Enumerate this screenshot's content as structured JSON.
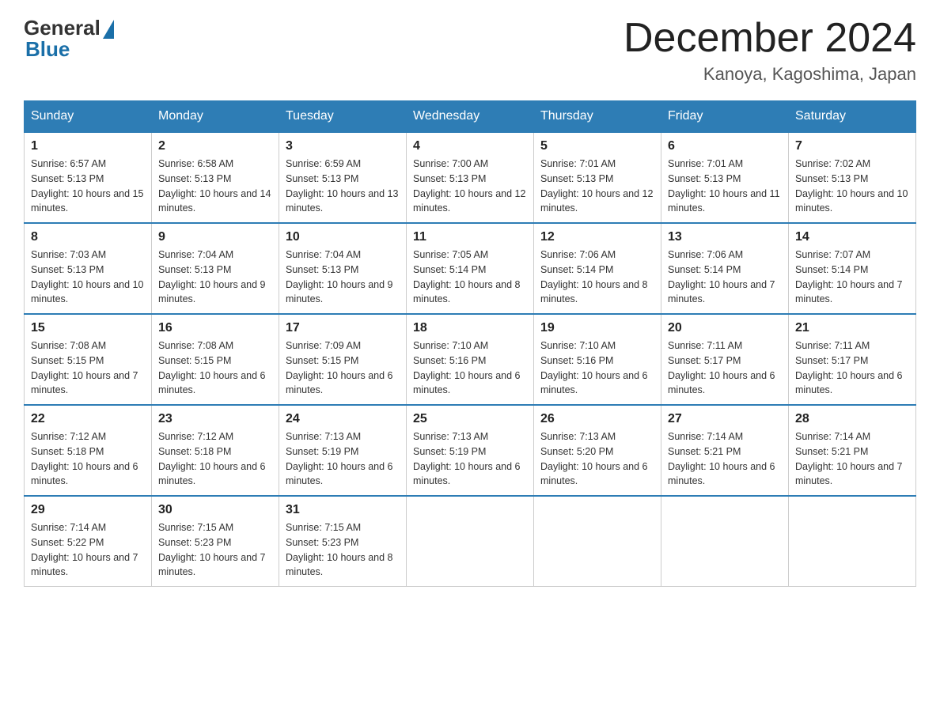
{
  "header": {
    "logo_general": "General",
    "logo_blue": "Blue",
    "month_title": "December 2024",
    "location": "Kanoya, Kagoshima, Japan"
  },
  "days_of_week": [
    "Sunday",
    "Monday",
    "Tuesday",
    "Wednesday",
    "Thursday",
    "Friday",
    "Saturday"
  ],
  "weeks": [
    [
      {
        "day": "1",
        "sunrise": "6:57 AM",
        "sunset": "5:13 PM",
        "daylight": "10 hours and 15 minutes."
      },
      {
        "day": "2",
        "sunrise": "6:58 AM",
        "sunset": "5:13 PM",
        "daylight": "10 hours and 14 minutes."
      },
      {
        "day": "3",
        "sunrise": "6:59 AM",
        "sunset": "5:13 PM",
        "daylight": "10 hours and 13 minutes."
      },
      {
        "day": "4",
        "sunrise": "7:00 AM",
        "sunset": "5:13 PM",
        "daylight": "10 hours and 12 minutes."
      },
      {
        "day": "5",
        "sunrise": "7:01 AM",
        "sunset": "5:13 PM",
        "daylight": "10 hours and 12 minutes."
      },
      {
        "day": "6",
        "sunrise": "7:01 AM",
        "sunset": "5:13 PM",
        "daylight": "10 hours and 11 minutes."
      },
      {
        "day": "7",
        "sunrise": "7:02 AM",
        "sunset": "5:13 PM",
        "daylight": "10 hours and 10 minutes."
      }
    ],
    [
      {
        "day": "8",
        "sunrise": "7:03 AM",
        "sunset": "5:13 PM",
        "daylight": "10 hours and 10 minutes."
      },
      {
        "day": "9",
        "sunrise": "7:04 AM",
        "sunset": "5:13 PM",
        "daylight": "10 hours and 9 minutes."
      },
      {
        "day": "10",
        "sunrise": "7:04 AM",
        "sunset": "5:13 PM",
        "daylight": "10 hours and 9 minutes."
      },
      {
        "day": "11",
        "sunrise": "7:05 AM",
        "sunset": "5:14 PM",
        "daylight": "10 hours and 8 minutes."
      },
      {
        "day": "12",
        "sunrise": "7:06 AM",
        "sunset": "5:14 PM",
        "daylight": "10 hours and 8 minutes."
      },
      {
        "day": "13",
        "sunrise": "7:06 AM",
        "sunset": "5:14 PM",
        "daylight": "10 hours and 7 minutes."
      },
      {
        "day": "14",
        "sunrise": "7:07 AM",
        "sunset": "5:14 PM",
        "daylight": "10 hours and 7 minutes."
      }
    ],
    [
      {
        "day": "15",
        "sunrise": "7:08 AM",
        "sunset": "5:15 PM",
        "daylight": "10 hours and 7 minutes."
      },
      {
        "day": "16",
        "sunrise": "7:08 AM",
        "sunset": "5:15 PM",
        "daylight": "10 hours and 6 minutes."
      },
      {
        "day": "17",
        "sunrise": "7:09 AM",
        "sunset": "5:15 PM",
        "daylight": "10 hours and 6 minutes."
      },
      {
        "day": "18",
        "sunrise": "7:10 AM",
        "sunset": "5:16 PM",
        "daylight": "10 hours and 6 minutes."
      },
      {
        "day": "19",
        "sunrise": "7:10 AM",
        "sunset": "5:16 PM",
        "daylight": "10 hours and 6 minutes."
      },
      {
        "day": "20",
        "sunrise": "7:11 AM",
        "sunset": "5:17 PM",
        "daylight": "10 hours and 6 minutes."
      },
      {
        "day": "21",
        "sunrise": "7:11 AM",
        "sunset": "5:17 PM",
        "daylight": "10 hours and 6 minutes."
      }
    ],
    [
      {
        "day": "22",
        "sunrise": "7:12 AM",
        "sunset": "5:18 PM",
        "daylight": "10 hours and 6 minutes."
      },
      {
        "day": "23",
        "sunrise": "7:12 AM",
        "sunset": "5:18 PM",
        "daylight": "10 hours and 6 minutes."
      },
      {
        "day": "24",
        "sunrise": "7:13 AM",
        "sunset": "5:19 PM",
        "daylight": "10 hours and 6 minutes."
      },
      {
        "day": "25",
        "sunrise": "7:13 AM",
        "sunset": "5:19 PM",
        "daylight": "10 hours and 6 minutes."
      },
      {
        "day": "26",
        "sunrise": "7:13 AM",
        "sunset": "5:20 PM",
        "daylight": "10 hours and 6 minutes."
      },
      {
        "day": "27",
        "sunrise": "7:14 AM",
        "sunset": "5:21 PM",
        "daylight": "10 hours and 6 minutes."
      },
      {
        "day": "28",
        "sunrise": "7:14 AM",
        "sunset": "5:21 PM",
        "daylight": "10 hours and 7 minutes."
      }
    ],
    [
      {
        "day": "29",
        "sunrise": "7:14 AM",
        "sunset": "5:22 PM",
        "daylight": "10 hours and 7 minutes."
      },
      {
        "day": "30",
        "sunrise": "7:15 AM",
        "sunset": "5:23 PM",
        "daylight": "10 hours and 7 minutes."
      },
      {
        "day": "31",
        "sunrise": "7:15 AM",
        "sunset": "5:23 PM",
        "daylight": "10 hours and 8 minutes."
      },
      null,
      null,
      null,
      null
    ]
  ]
}
